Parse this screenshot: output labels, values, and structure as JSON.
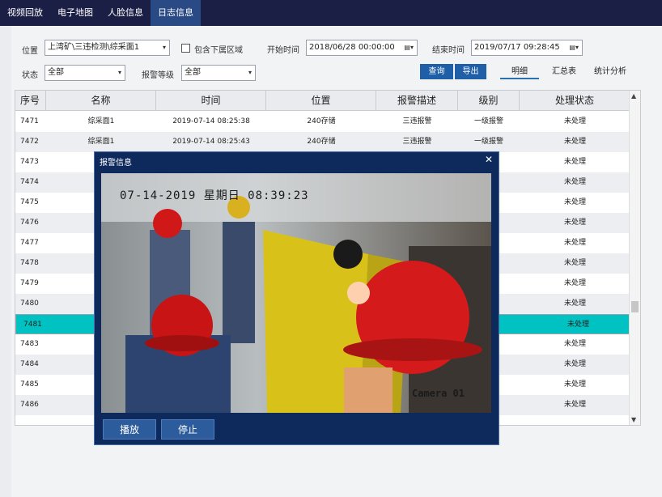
{
  "nav": {
    "tabs": [
      "视频回放",
      "电子地图",
      "人脸信息",
      "日志信息"
    ],
    "active_index": 3
  },
  "filter": {
    "location_label": "位置",
    "location_value": "上湾矿\\三违检测\\综采面1",
    "include_sub_label": "包含下属区域",
    "start_label": "开始时间",
    "start_value": "2018/06/28   00:00:00",
    "end_label": "结束时间",
    "end_value": "2019/07/17   09:28:45",
    "status_label": "状态",
    "status_value": "全部",
    "level_label": "报警等级",
    "level_value": "全部",
    "query_label": "查询",
    "export_label": "导出",
    "tab_detail": "明细",
    "tab_summary": "汇总表",
    "tab_stats": "统计分析"
  },
  "table": {
    "headers": [
      "序号",
      "名称",
      "时间",
      "位置",
      "报警描述",
      "级别",
      "处理状态"
    ],
    "rows": [
      {
        "id": "7471",
        "name": "综采面1",
        "time": "2019-07-14 08:25:38",
        "loc": "240存储",
        "desc": "三违报警",
        "level": "一级报警",
        "status": "未处理"
      },
      {
        "id": "7472",
        "name": "综采面1",
        "time": "2019-07-14 08:25:43",
        "loc": "240存储",
        "desc": "三违报警",
        "level": "一级报警",
        "status": "未处理"
      },
      {
        "id": "7473",
        "name": "综",
        "time": "",
        "loc": "",
        "desc": "",
        "level": "警",
        "status": "未处理"
      },
      {
        "id": "7474",
        "name": "综",
        "time": "",
        "loc": "",
        "desc": "",
        "level": "警",
        "status": "未处理"
      },
      {
        "id": "7475",
        "name": "综",
        "time": "",
        "loc": "",
        "desc": "",
        "level": "警",
        "status": "未处理"
      },
      {
        "id": "7476",
        "name": "综",
        "time": "",
        "loc": "",
        "desc": "",
        "level": "警",
        "status": "未处理"
      },
      {
        "id": "7477",
        "name": "综",
        "time": "",
        "loc": "",
        "desc": "",
        "level": "警",
        "status": "未处理"
      },
      {
        "id": "7478",
        "name": "综",
        "time": "",
        "loc": "",
        "desc": "",
        "level": "警",
        "status": "未处理"
      },
      {
        "id": "7479",
        "name": "综",
        "time": "",
        "loc": "",
        "desc": "",
        "level": "警",
        "status": "未处理"
      },
      {
        "id": "7480",
        "name": "综",
        "time": "",
        "loc": "",
        "desc": "",
        "level": "警",
        "status": "未处理"
      },
      {
        "id": "7481",
        "name": "综",
        "time": "",
        "loc": "",
        "desc": "",
        "level": "警",
        "status": "未处理"
      },
      {
        "id": "7482",
        "name": "综",
        "time": "",
        "loc": "",
        "desc": "",
        "level": "警",
        "status": "未处理"
      },
      {
        "id": "7483",
        "name": "综",
        "time": "",
        "loc": "",
        "desc": "",
        "level": "警",
        "status": "未处理"
      },
      {
        "id": "7484",
        "name": "综",
        "time": "",
        "loc": "",
        "desc": "",
        "level": "警",
        "status": "未处理"
      },
      {
        "id": "7485",
        "name": "综",
        "time": "",
        "loc": "",
        "desc": "",
        "level": "警",
        "status": "未处理"
      },
      {
        "id": "7486",
        "name": "综",
        "time": "",
        "loc": "",
        "desc": "",
        "level": "警",
        "status": "未处理"
      }
    ],
    "selected_index": 10
  },
  "dialog": {
    "title": "报警信息",
    "close_icon": "close-icon",
    "video_timestamp": "07-14-2019 星期日 08:39:23",
    "video_camera": "Camera 01",
    "play_label": "播放",
    "stop_label": "停止"
  },
  "colors": {
    "nav_bg": "#1c1f45",
    "nav_active": "#2a4a86",
    "selected_row": "#00c2c2",
    "dialog_bg": "#0e2a5c",
    "button": "#1f5fa8"
  }
}
